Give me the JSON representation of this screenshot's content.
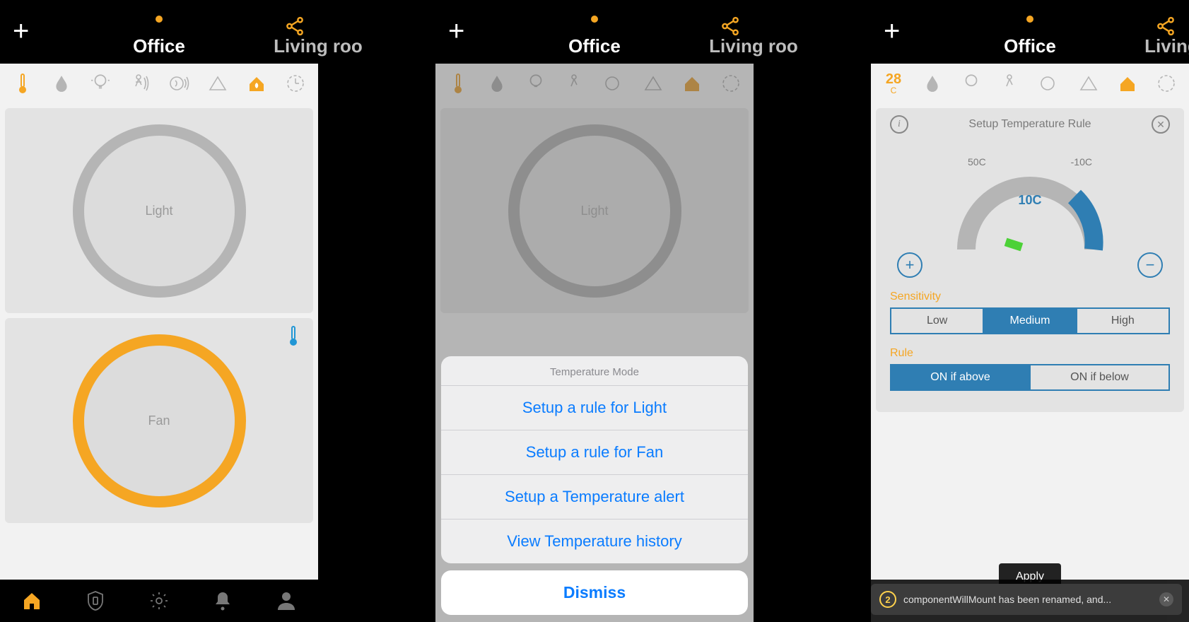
{
  "colors": {
    "accent": "#f5a623",
    "link": "#0a7cff",
    "blue": "#2f7eb3"
  },
  "header": {
    "tab_active": "Office",
    "tab_secondary": "Living roo"
  },
  "devices": [
    {
      "name": "Light",
      "active": false
    },
    {
      "name": "Fan",
      "active": true,
      "indicator_icon": "thermometer-icon"
    }
  ],
  "bottom_tabs": [
    "home",
    "shield",
    "settings",
    "bell",
    "user"
  ],
  "sensor_icons": [
    "thermometer",
    "droplet",
    "bulb",
    "motion",
    "noise",
    "co2",
    "eco",
    "timer"
  ],
  "screen3_temp": {
    "value": "28",
    "unit": "C"
  },
  "action_sheet": {
    "title": "Temperature Mode",
    "items": [
      "Setup a rule for Light",
      "Setup a rule for Fan",
      "Setup a Temperature alert",
      "View Temperature history"
    ],
    "dismiss": "Dismiss"
  },
  "setup_panel": {
    "title": "Setup Temperature Rule",
    "max_label": "50C",
    "min_label": "-10C",
    "current": "10C",
    "sensitivity_label": "Sensitivity",
    "sensitivity_options": [
      "Low",
      "Medium",
      "High"
    ],
    "sensitivity_selected": 1,
    "rule_label": "Rule",
    "rule_options": [
      "ON if above",
      "ON if below"
    ],
    "rule_selected": 0,
    "apply": "Apply"
  },
  "toast": {
    "count": "2",
    "text": "componentWillMount has been renamed, and..."
  }
}
